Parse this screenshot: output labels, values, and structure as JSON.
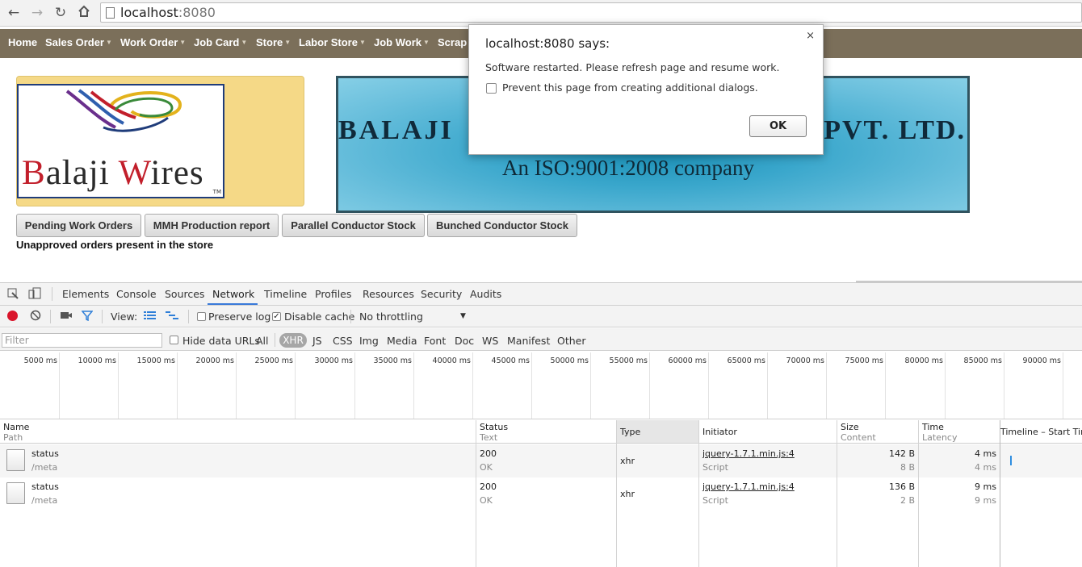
{
  "browser": {
    "url_host": "localhost",
    "url_port": ":8080"
  },
  "menubar": {
    "items": [
      {
        "label": "Home",
        "has_dropdown": false
      },
      {
        "label": "Sales Order",
        "has_dropdown": true
      },
      {
        "label": "Work Order",
        "has_dropdown": true
      },
      {
        "label": "Job Card",
        "has_dropdown": true
      },
      {
        "label": "Store",
        "has_dropdown": true
      },
      {
        "label": "Labor Store",
        "has_dropdown": true
      },
      {
        "label": "Job Work",
        "has_dropdown": true
      },
      {
        "label": "Scrap",
        "has_dropdown": false
      }
    ]
  },
  "logo": {
    "brand_first": "B",
    "brand_mid": "alaji ",
    "brand_w": "W",
    "brand_rest": "ires",
    "tm": "TM"
  },
  "banner": {
    "company_left": "BALAJI",
    "company_right": "PVT. LTD.",
    "iso": "An ISO:9001:2008 company"
  },
  "actions": {
    "buttons": [
      "Pending Work Orders",
      "MMH Production report",
      "Parallel Conductor Stock",
      "Bunched Conductor Stock"
    ],
    "notice": "Unapproved orders present in the store"
  },
  "devtools": {
    "tabs": [
      "Elements",
      "Console",
      "Sources",
      "Network",
      "Timeline",
      "Profiles",
      "Resources",
      "Security",
      "Audits"
    ],
    "active_tab": "Network",
    "controls": {
      "view_label": "View:",
      "preserve_log": "Preserve log",
      "preserve_log_checked": false,
      "disable_cache": "Disable cache",
      "disable_cache_checked": true,
      "throttling": "No throttling"
    },
    "filter": {
      "placeholder": "Filter",
      "hide_data_urls": "Hide data URLs",
      "types": [
        "All",
        "XHR",
        "JS",
        "CSS",
        "Img",
        "Media",
        "Font",
        "Doc",
        "WS",
        "Manifest",
        "Other"
      ],
      "selected_type": "XHR"
    },
    "timeline_ticks": [
      "5000 ms",
      "10000 ms",
      "15000 ms",
      "20000 ms",
      "25000 ms",
      "30000 ms",
      "35000 ms",
      "40000 ms",
      "45000 ms",
      "50000 ms",
      "55000 ms",
      "60000 ms",
      "65000 ms",
      "70000 ms",
      "75000 ms",
      "80000 ms",
      "85000 ms",
      "90000 ms"
    ],
    "columns": {
      "name": "Name",
      "name_sub": "Path",
      "status": "Status",
      "status_sub": "Text",
      "type": "Type",
      "initiator": "Initiator",
      "size": "Size",
      "size_sub": "Content",
      "time": "Time",
      "time_sub": "Latency",
      "timeline": "Timeline – Start Time"
    },
    "rows": [
      {
        "name": "status",
        "path": "/meta",
        "status": "200",
        "status_text": "OK",
        "type": "xhr",
        "initiator": "jquery-1.7.1.min.js:4",
        "initiator_type": "Script",
        "size": "142 B",
        "content": "8 B",
        "time": "4 ms",
        "latency": "4 ms"
      },
      {
        "name": "status",
        "path": "/meta",
        "status": "200",
        "status_text": "OK",
        "type": "xhr",
        "initiator": "jquery-1.7.1.min.js:4",
        "initiator_type": "Script",
        "size": "136 B",
        "content": "2 B",
        "time": "9 ms",
        "latency": "9 ms"
      }
    ]
  },
  "dialog": {
    "title": "localhost:8080 says:",
    "message": "Software restarted. Please refresh page and resume work.",
    "checkbox_label": "Prevent this page from creating additional dialogs.",
    "checkbox_checked": false,
    "ok_label": "OK",
    "close_glyph": "×"
  }
}
